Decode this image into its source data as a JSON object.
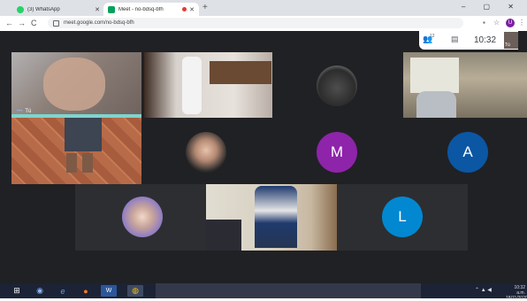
{
  "browser": {
    "tabs": [
      {
        "title": "(3) WhatsApp",
        "favicon_color": "#25d366"
      },
      {
        "title": "Meet - no-bdsq-bfh",
        "favicon_color": "#00a25c"
      }
    ],
    "new_tab": "+",
    "window_controls": "– ▢ ✕",
    "back": "←",
    "forward": "→",
    "reload": "C",
    "url": "meet.google.com/no-bdsq-bfh",
    "profile_initial": "U"
  },
  "meet": {
    "people_count": "12",
    "time": "10:32",
    "self_label": "Tú",
    "participants": [
      {
        "label": "Tú",
        "type": "video"
      },
      {
        "type": "video"
      },
      {
        "type": "avatar-photo"
      },
      {
        "type": "video"
      },
      {
        "type": "video"
      },
      {
        "type": "avatar-photo"
      },
      {
        "initial": "M",
        "color": "#8e24aa"
      },
      {
        "initial": "A",
        "color": "#0b57a4"
      },
      {
        "type": "avatar-photo"
      },
      {
        "type": "video"
      },
      {
        "initial": "L",
        "color": "#0288d1"
      }
    ]
  },
  "taskbar": {
    "clock_time": "10:32 a.m.",
    "clock_date": "18/11/2020"
  }
}
